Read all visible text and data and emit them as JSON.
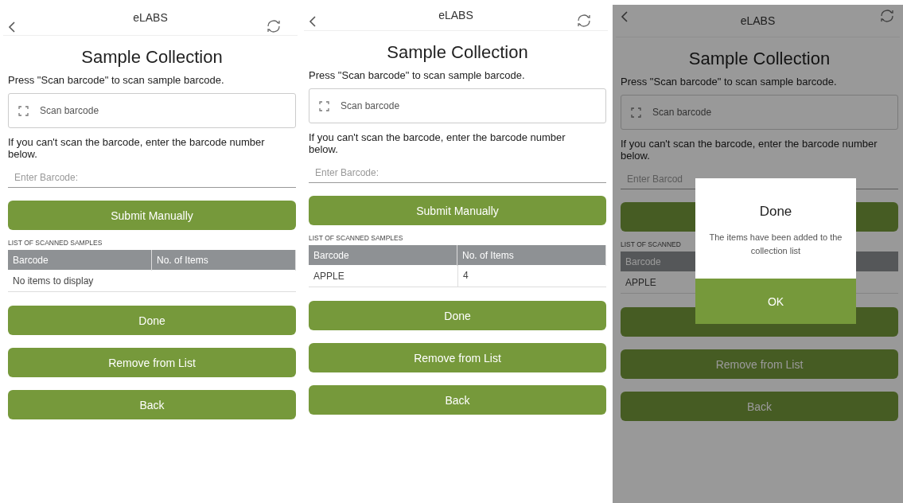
{
  "screens": [
    {
      "app_title": "eLABS",
      "heading": "Sample Collection",
      "instruction": "Press \"Scan barcode\" to scan sample barcode.",
      "scan_button": "Scan barcode",
      "manual_hint": "If you can't scan the barcode, enter the barcode number below.",
      "barcode_field": {
        "placeholder": "Enter Barcode:"
      },
      "submit_button": "Submit Manually",
      "list_label": "LIST OF SCANNED SAMPLES",
      "table": {
        "columns": [
          "Barcode",
          "No. of Items"
        ],
        "empty_text": "No items to display"
      },
      "done_button": "Done",
      "remove_button": "Remove from List",
      "back_button": "Back",
      "dimmed": false
    },
    {
      "app_title": "eLABS",
      "heading": "Sample Collection",
      "instruction": "Press \"Scan barcode\" to scan sample barcode.",
      "scan_button": "Scan barcode",
      "manual_hint": "If you can't scan the barcode, enter the barcode number below.",
      "barcode_field": {
        "placeholder": "Enter Barcode:"
      },
      "submit_button": "Submit Manually",
      "list_label": "LIST OF SCANNED SAMPLES",
      "table": {
        "columns": [
          "Barcode",
          "No. of Items"
        ],
        "rows": [
          [
            "APPLE",
            "4"
          ]
        ]
      },
      "done_button": "Done",
      "remove_button": "Remove from List",
      "back_button": "Back",
      "dimmed": false
    },
    {
      "app_title": "eLABS",
      "heading": "Sample Collection",
      "instruction": "Press \"Scan barcode\" to scan sample barcode.",
      "scan_button": "Scan barcode",
      "manual_hint": "If you can't scan the barcode, enter the barcode number below.",
      "barcode_field": {
        "placeholder": "Enter Barcod"
      },
      "list_label": "LIST OF SCANNED",
      "table": {
        "columns": [
          "Barcode"
        ],
        "rows": [
          [
            "APPLE"
          ]
        ]
      },
      "remove_button": "Remove from List",
      "back_button": "Back",
      "dimmed": true,
      "dialog": {
        "title": "Done",
        "message": "The items have been added to the collection list",
        "ok_button": "OK"
      }
    }
  ]
}
